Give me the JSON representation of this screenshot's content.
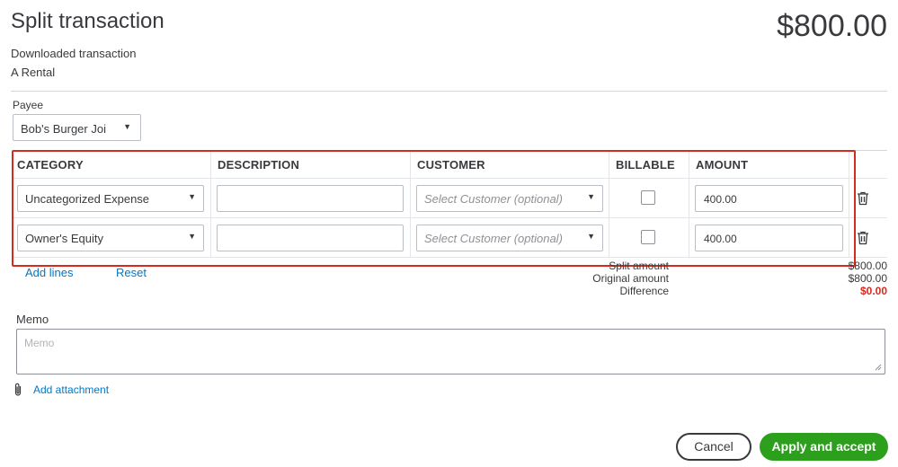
{
  "header": {
    "title": "Split transaction",
    "total": "$800.00",
    "subtitle": "Downloaded transaction",
    "description": "A Rental"
  },
  "payee": {
    "label": "Payee",
    "value": "Bob's Burger Joi"
  },
  "table": {
    "columns": [
      "CATEGORY",
      "DESCRIPTION",
      "CUSTOMER",
      "BILLABLE",
      "AMOUNT"
    ],
    "rows": [
      {
        "category": "Uncategorized Expense",
        "description": "",
        "customer_placeholder": "Select Customer (optional)",
        "billable": false,
        "amount": "400.00"
      },
      {
        "category": "Owner's Equity",
        "description": "",
        "customer_placeholder": "Select Customer (optional)",
        "billable": false,
        "amount": "400.00"
      }
    ],
    "highlight_color": "#d52b1e"
  },
  "actions": {
    "add_lines": "Add lines",
    "reset": "Reset"
  },
  "summary": {
    "split_amount_label": "Split amount",
    "split_amount": "$800.00",
    "original_amount_label": "Original amount",
    "original_amount": "$800.00",
    "difference_label": "Difference",
    "difference": "$0.00",
    "difference_color": "#d52b1e"
  },
  "memo": {
    "label": "Memo",
    "placeholder": "Memo"
  },
  "attachment": {
    "link": "Add attachment"
  },
  "footer": {
    "cancel": "Cancel",
    "apply": "Apply and accept",
    "apply_color": "#2ca01c"
  },
  "icons": {
    "dropdown": "caret-down-icon",
    "delete": "trash-icon",
    "attachment": "paperclip-icon",
    "resize": "resize-grip-icon"
  }
}
